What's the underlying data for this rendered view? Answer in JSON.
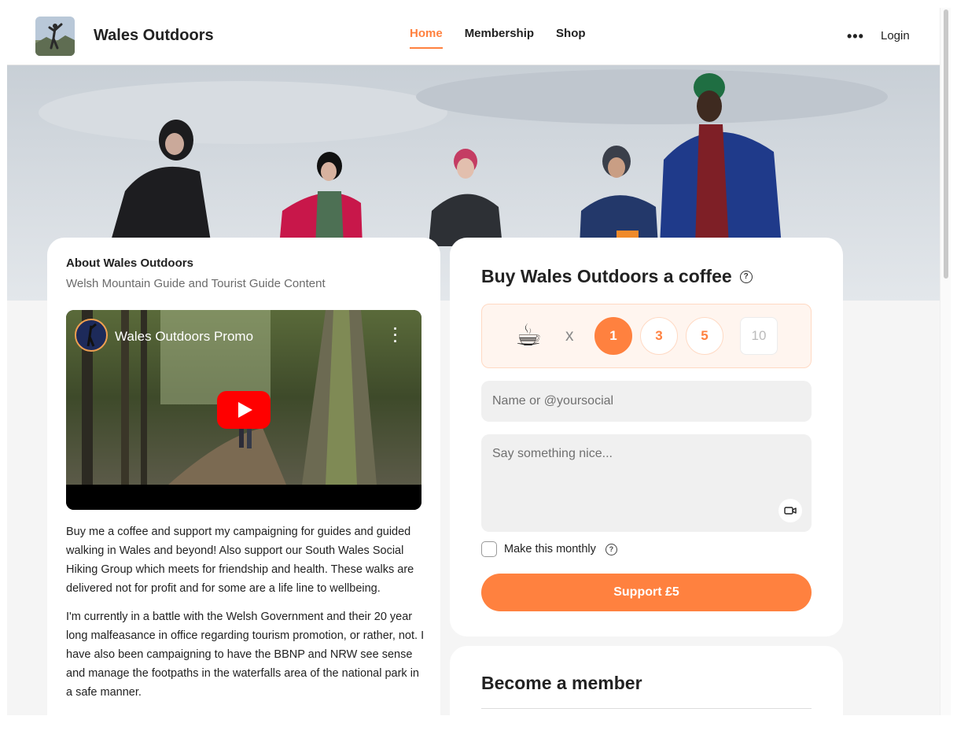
{
  "header": {
    "brand": "Wales Outdoors",
    "nav": [
      "Home",
      "Membership",
      "Shop"
    ],
    "active_nav": "Home",
    "more_icon": "more-dots-icon",
    "login": "Login"
  },
  "about": {
    "title": "About Wales Outdoors",
    "subtitle": "Welsh Mountain Guide and Tourist Guide Content",
    "video": {
      "title": "Wales Outdoors Promo",
      "play_icon": "youtube-play-icon"
    },
    "paragraphs": [
      "Buy me a coffee and support my campaigning for guides and guided walking in Wales and beyond! Also support our South Wales Social Hiking Group which meets for friendship and health. These walks are delivered not for profit and for some are a life line to wellbeing.",
      "I'm currently in a battle with the Welsh Government and their 20 year long malfeasance in office regarding tourism promotion, or rather, not. I have also been campaigning to have the BBNP and NRW see sense and manage the footpaths in the waterfalls area of the national park in a safe manner."
    ]
  },
  "coffee": {
    "title": "Buy Wales Outdoors a coffee",
    "cup_emoji": "☕",
    "times": "x",
    "quantities": [
      "1",
      "3",
      "5"
    ],
    "selected_quantity": "1",
    "custom_quantity_placeholder": "10",
    "name_placeholder": "Name or @yoursocial",
    "message_placeholder": "Say something nice...",
    "monthly_label": "Make this monthly",
    "support_button": "Support £5"
  },
  "member": {
    "title": "Become a member"
  },
  "colors": {
    "accent": "#ff813f",
    "accent_light": "#fff5ef",
    "field_bg": "#f0f0f0",
    "page_bg": "#f5f5f5"
  }
}
